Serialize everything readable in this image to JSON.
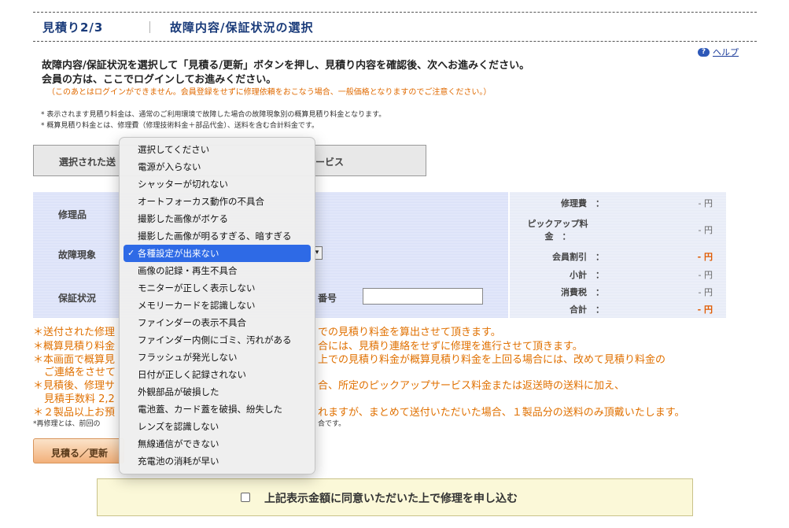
{
  "header": {
    "step": "見積り2/3",
    "separator": "｜",
    "title": "故障内容/保証状況の選択"
  },
  "help": {
    "icon": "?",
    "label": "ヘルプ"
  },
  "intro": {
    "line1": "故障内容/保証状況を選択して「見積る/更新」ボタンを押し、見積り内容を確認後、次へお進みください。",
    "line2": "会員の方は、ここでログインしてお進みください。",
    "line3": "（このあとはログインができません。会員登録をせずに修理依頼をおこなう場合、一般価格となりますのでご注意ください。）"
  },
  "notes": [
    "* 表示されます見積り料金は、通常のご利用環境で故障した場合の故障現象別の概算見積り料金となります。",
    "* 概算見積り料金とは、修理費（修理技術料金＋部品代金）、送料を含む合計料金です。"
  ],
  "selected_box": {
    "left": "選択された送",
    "right": "ービス"
  },
  "form": {
    "repair_item_label": "修理品",
    "fault_label": "故障現象",
    "warranty_label": "保証状況",
    "number_label": "番号",
    "number_value": ""
  },
  "summary": [
    {
      "label": "修理費　：",
      "value": "- 円",
      "red": false
    },
    {
      "label": "ピックアップ料\n金　：",
      "value": "- 円",
      "red": false
    },
    {
      "label": "会員割引　：",
      "value": "- 円",
      "red": true
    },
    {
      "label": "小計　：",
      "value": "- 円",
      "red": false
    },
    {
      "label": "消費税　：",
      "value": "- 円",
      "red": false
    },
    {
      "label": "合計　：",
      "value": "- 円",
      "red": true
    }
  ],
  "warnings": [
    "＊送付された修理",
    "＊概算見積り料金",
    "＊本画面で概算見",
    "ご連絡をさせて",
    "＊見積後、修理サ",
    "見積手数料 2,2",
    "＊２製品以上お預",
    "*再修理とは、前回の"
  ],
  "warnings_right": [
    "での見積り料金を算出させて頂きます。",
    "合には、見積り連絡をせずに修理を進行させて頂きます。",
    "上での見積り料金が概算見積り料金を上回る場合には、改めて見積り料金の",
    "合、所定のピックアップサービス料金または返送時の送料に加え、",
    "れますが、まとめて送付いただいた場合、１製品分の送料のみ頂戴いたします。",
    "合です。"
  ],
  "quote_button": "見積る／更新",
  "agree": {
    "label": "上記表示金額に同意いただいた上で修理を申し込む",
    "checked": false
  },
  "dropdown": {
    "selected_index": 6,
    "check_mark": "✓",
    "options": [
      "選択してください",
      "電源が入らない",
      "シャッターが切れない",
      "オートフォーカス動作の不具合",
      "撮影した画像がボケる",
      "撮影した画像が明るすぎる、暗すぎる",
      "各種設定が出来ない",
      "画像の記録・再生不具合",
      "モニターが正しく表示しない",
      "メモリーカードを認識しない",
      "ファインダーの表示不具合",
      "ファインダー内側にゴミ、汚れがある",
      "フラッシュが発光しない",
      "日付が正しく記録されない",
      "外観部品が破損した",
      "電池蓋、カード蓋を破損、紛失した",
      "レンズを認識しない",
      "無線通信ができない",
      "充電池の消耗が早い"
    ]
  }
}
